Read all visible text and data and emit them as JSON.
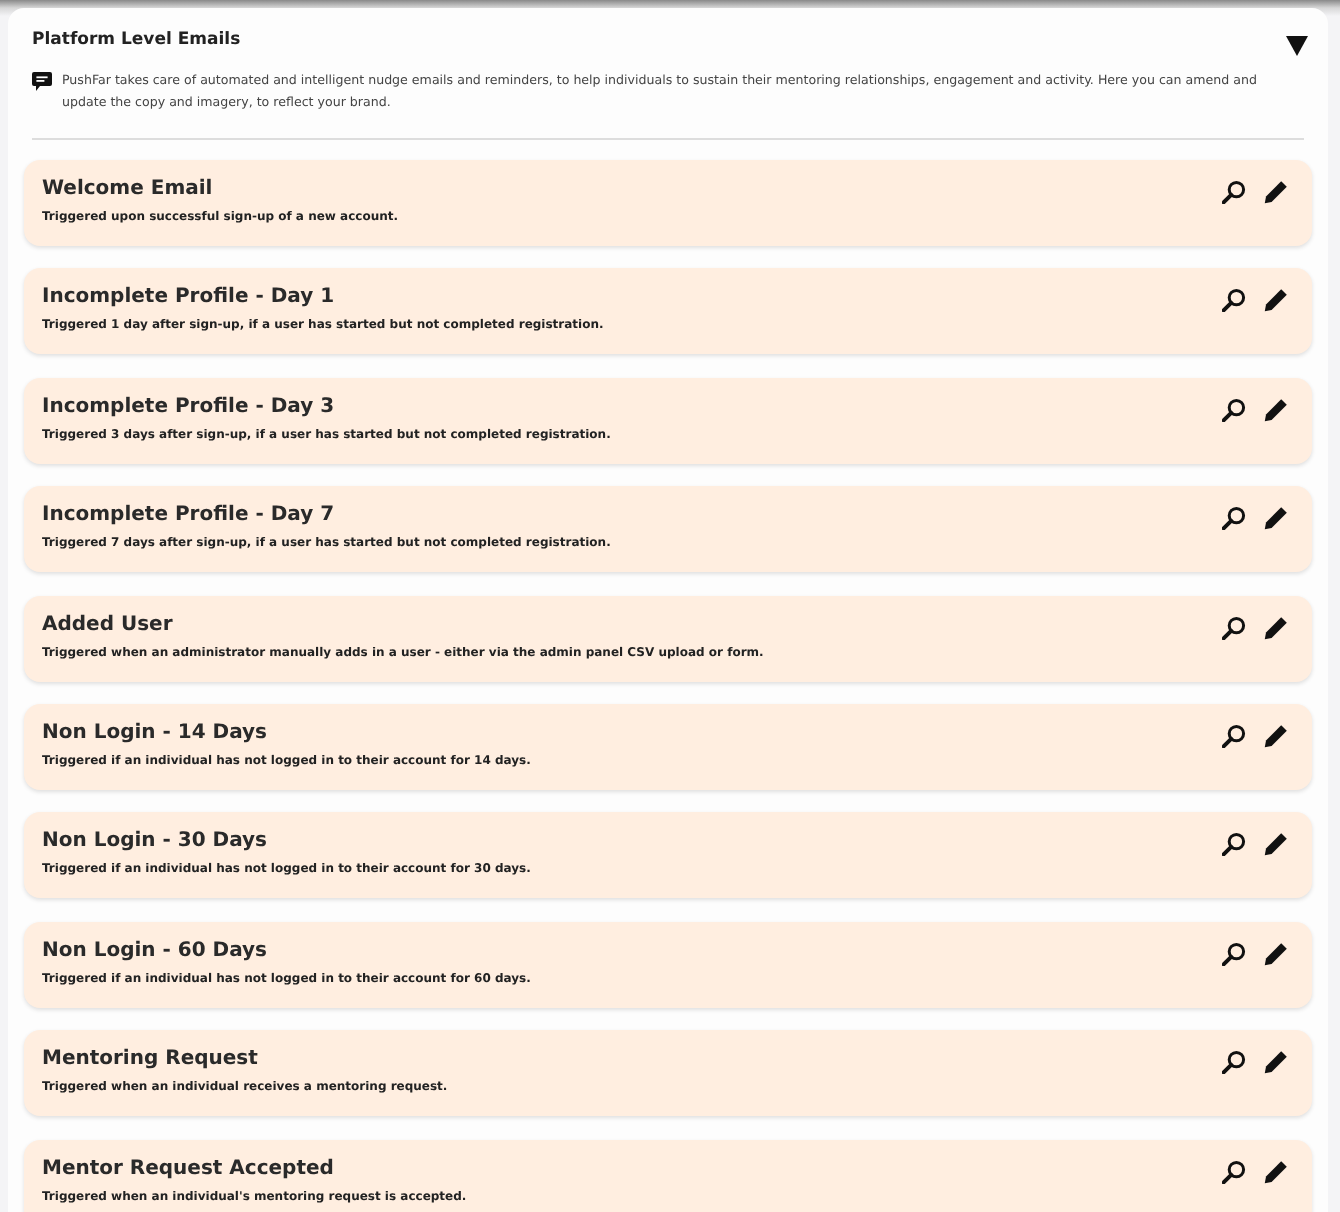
{
  "panel": {
    "title": "Platform Level Emails",
    "expanded": true,
    "description": "PushFar takes care of automated and intelligent nudge emails and reminders, to help individuals to sustain their mentoring relationships, engagement and activity. Here you can amend and update the copy and imagery, to reflect your brand."
  },
  "emails": [
    {
      "title": "Welcome Email",
      "description": "Triggered upon successful sign-up of a new account."
    },
    {
      "title": "Incomplete Profile - Day 1",
      "description": "Triggered 1 day after sign-up, if a user has started but not completed registration."
    },
    {
      "title": "Incomplete Profile - Day 3",
      "description": "Triggered 3 days after sign-up, if a user has started but not completed registration."
    },
    {
      "title": "Incomplete Profile - Day 7",
      "description": "Triggered 7 days after sign-up, if a user has started but not completed registration."
    },
    {
      "title": "Added User",
      "description": "Triggered when an administrator manually adds in a user - either via the admin panel CSV upload or form."
    },
    {
      "title": "Non Login - 14 Days",
      "description": "Triggered if an individual has not logged in to their account for 14 days."
    },
    {
      "title": "Non Login - 30 Days",
      "description": "Triggered if an individual has not logged in to their account for 30 days."
    },
    {
      "title": "Non Login - 60 Days",
      "description": "Triggered if an individual has not logged in to their account for 60 days."
    },
    {
      "title": "Mentoring Request",
      "description": "Triggered when an individual receives a mentoring request."
    },
    {
      "title": "Mentor Request Accepted",
      "description": "Triggered when an individual's mentoring request is accepted."
    }
  ]
}
